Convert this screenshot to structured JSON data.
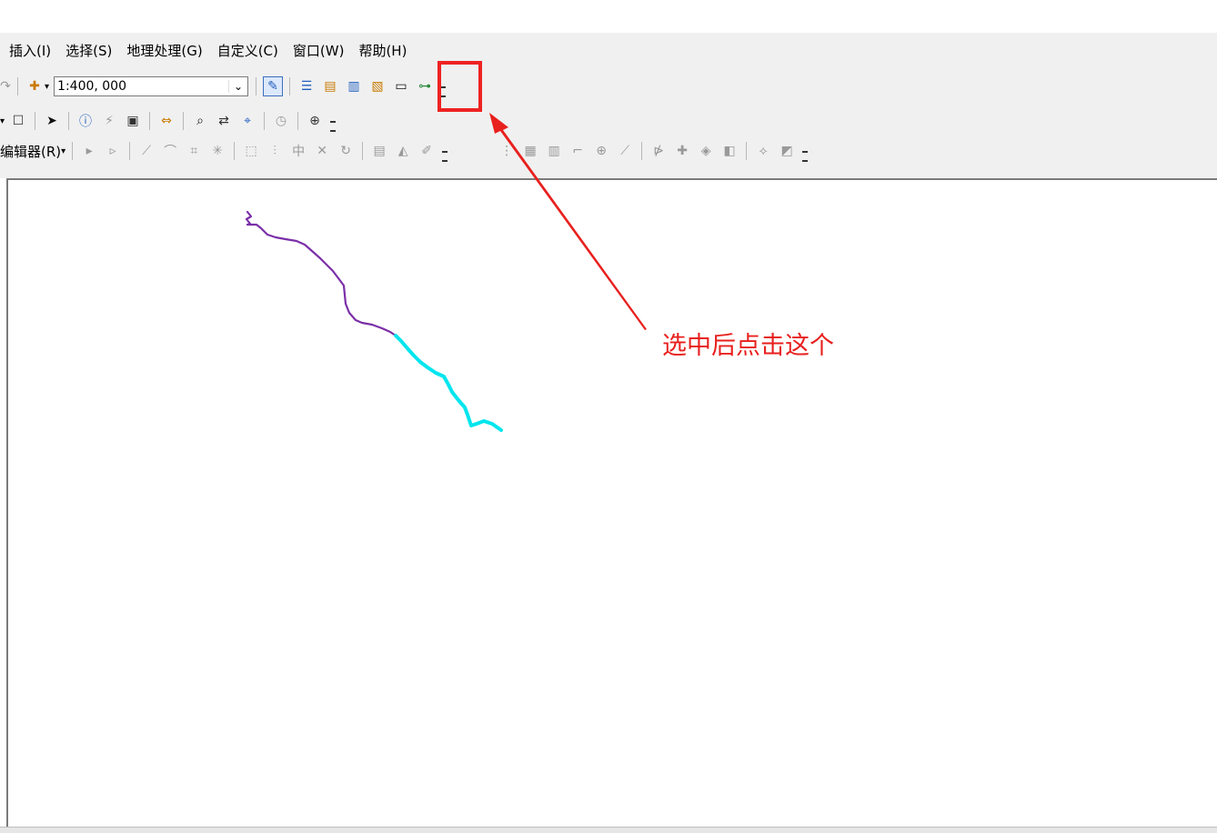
{
  "menubar": {
    "items": [
      "插入(I)",
      "选择(S)",
      "地理处理(G)",
      "自定义(C)",
      "窗口(W)",
      "帮助(H)"
    ]
  },
  "toolbar1": {
    "scale_value": "1:400, 000"
  },
  "toolbar3": {
    "editor_label": "编辑器(R)"
  },
  "annotation": {
    "text": "选中后点击这个",
    "color": "#e8201e"
  },
  "map": {
    "line_colors": [
      "#7b2fa8",
      "#00e5ee"
    ]
  }
}
